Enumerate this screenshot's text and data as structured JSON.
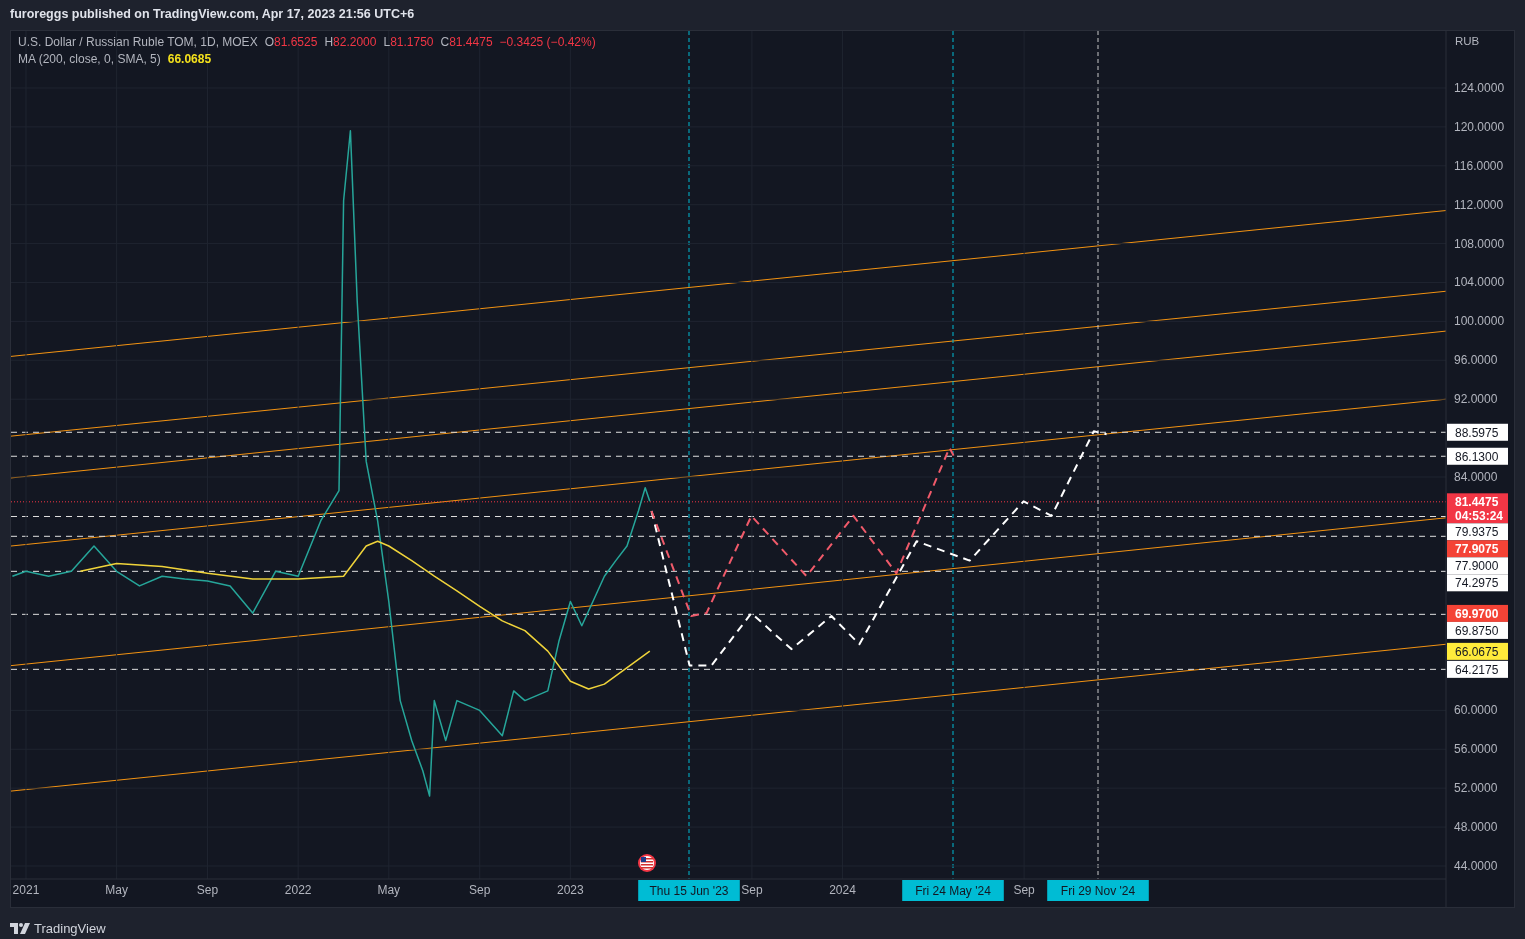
{
  "header": {
    "text": "furoreggs published on TradingView.com, Apr 17, 2023 21:56 UTC+6"
  },
  "legend": {
    "symbol": "U.S. Dollar / Russian Ruble TOM, 1D, MOEX",
    "ohlc": [
      {
        "label": "O",
        "value": "81.6525"
      },
      {
        "label": "H",
        "value": "82.2000"
      },
      {
        "label": "L",
        "value": "81.1750"
      },
      {
        "label": "C",
        "value": "81.4475"
      }
    ],
    "change": "−0.3425 (−0.42%)",
    "indicator_value": "66.0685"
  },
  "chart": {
    "currency": "RUB",
    "event_marker": {
      "kind": "flag"
    },
    "date_markers": [
      {
        "label": "Thu 15 Jun '23"
      },
      {
        "label": "Fri 24 May '24"
      },
      {
        "label": "Fri 29 Nov '24"
      }
    ],
    "price_badges": [
      {
        "kind": "level",
        "label": "88.5975"
      },
      {
        "kind": "level",
        "label": "86.1300"
      },
      {
        "kind": "last_price",
        "label": "81.4475",
        "countdown": "04:53:24"
      },
      {
        "kind": "level",
        "label": "79.9375"
      },
      {
        "kind": "alert",
        "label": "77.9075"
      },
      {
        "kind": "level",
        "label": "77.9000"
      },
      {
        "kind": "level",
        "label": "74.2975"
      },
      {
        "kind": "alert",
        "label": "69.9700"
      },
      {
        "kind": "level",
        "label": "69.8750"
      },
      {
        "kind": "average",
        "label": "66.0675"
      },
      {
        "kind": "level",
        "label": "64.2175"
      }
    ],
    "chart_data": {
      "type": "line",
      "grid": true,
      "xlim": [
        2020.945,
        2026.217
      ],
      "ylim": [
        42.66,
        129.86
      ],
      "xticks": [
        {
          "value": 2021,
          "label": "2021"
        },
        {
          "value": 2021.333,
          "label": "May"
        },
        {
          "value": 2021.667,
          "label": "Sep"
        },
        {
          "value": 2022,
          "label": "2022"
        },
        {
          "value": 2022.333,
          "label": "May"
        },
        {
          "value": 2022.667,
          "label": "Sep"
        },
        {
          "value": 2023,
          "label": "2023"
        },
        {
          "value": 2023.667,
          "label": "Sep"
        },
        {
          "value": 2024,
          "label": "2024"
        },
        {
          "value": 2024.667,
          "label": "Sep"
        }
      ],
      "yticks": [
        {
          "value": 124,
          "label": "124.0000"
        },
        {
          "value": 120,
          "label": "120.0000"
        },
        {
          "value": 116,
          "label": "116.0000"
        },
        {
          "value": 112,
          "label": "112.0000"
        },
        {
          "value": 108,
          "label": "108.0000"
        },
        {
          "value": 104,
          "label": "104.0000"
        },
        {
          "value": 100,
          "label": "100.0000"
        },
        {
          "value": 96,
          "label": "96.0000"
        },
        {
          "value": 92,
          "label": "92.0000"
        },
        {
          "value": 84,
          "label": "84.0000"
        },
        {
          "value": 60,
          "label": "60.0000"
        },
        {
          "value": 56,
          "label": "56.0000"
        },
        {
          "value": 52,
          "label": "52.0000"
        },
        {
          "value": 48,
          "label": "48.0000"
        },
        {
          "value": 44,
          "label": "44.0000"
        }
      ],
      "series": [
        {
          "color": "#26a69a",
          "x": [
            2020.95,
            2021,
            2021.083,
            2021.167,
            2021.25,
            2021.333,
            2021.417,
            2021.5,
            2021.583,
            2021.667,
            2021.75,
            2021.833,
            2021.917,
            2022,
            2022.083,
            2022.15,
            2022.167,
            2022.192,
            2022.217,
            2022.25,
            2022.292,
            2022.333,
            2022.375,
            2022.417,
            2022.458,
            2022.483,
            2022.5,
            2022.542,
            2022.583,
            2022.667,
            2022.75,
            2022.792,
            2022.833,
            2022.917,
            2022.958,
            2023,
            2023.042,
            2023.083,
            2023.125,
            2023.167,
            2023.208,
            2023.25,
            2023.275,
            2023.292
          ],
          "values": [
            73.8,
            74.3,
            73.8,
            74.3,
            76.9,
            74.3,
            72.8,
            73.8,
            73.5,
            73.3,
            72.8,
            70.0,
            74.3,
            73.8,
            79.5,
            82.6,
            112.4,
            119.6,
            102.1,
            85.6,
            79.5,
            71.2,
            61.0,
            56.9,
            53.8,
            51.2,
            61.0,
            56.9,
            61.0,
            60.0,
            57.4,
            62.0,
            61.0,
            62.0,
            67.1,
            71.2,
            68.7,
            71.2,
            73.8,
            75.4,
            76.9,
            80.5,
            82.9,
            81.5
          ]
        },
        {
          "name": "MA (200, close, 0, SMA, 5)",
          "color": "#f0d43a",
          "x": [
            2021.2,
            2021.333,
            2021.5,
            2021.667,
            2021.833,
            2022,
            2022.167,
            2022.25,
            2022.292,
            2022.333,
            2022.417,
            2022.5,
            2022.583,
            2022.667,
            2022.75,
            2022.833,
            2022.917,
            2023,
            2023.067,
            2023.125,
            2023.292
          ],
          "values": [
            74.3,
            75.1,
            74.8,
            74.1,
            73.5,
            73.5,
            73.8,
            76.9,
            77.4,
            76.9,
            75.4,
            73.8,
            72.3,
            70.7,
            69.2,
            68.2,
            66.1,
            63.0,
            62.2,
            62.7,
            66.1
          ]
        },
        {
          "color": "#ffffff",
          "line_style": "dashed",
          "x": [
            2023.298,
            2023.438,
            2023.518,
            2023.665,
            2023.812,
            2023.959,
            2024.062,
            2024.272,
            2024.467,
            2024.665,
            2024.768,
            2024.923,
            2024.97
          ],
          "values": [
            80.5,
            64.6,
            64.6,
            70.0,
            66.3,
            69.7,
            66.8,
            77.4,
            75.4,
            81.5,
            80.0,
            88.7,
            88.4
          ]
        },
        {
          "color": "#f05a6a",
          "line_style": "dashed",
          "x": [
            2023.298,
            2023.444,
            2023.5,
            2023.665,
            2023.868,
            2024.04,
            2024.198,
            2024.393,
            2024.408
          ],
          "values": [
            80.5,
            69.7,
            70.0,
            80.0,
            73.8,
            80.0,
            74.1,
            87.0,
            86.2
          ]
        }
      ]
    }
  },
  "footer": {
    "brand": "TradingView"
  }
}
